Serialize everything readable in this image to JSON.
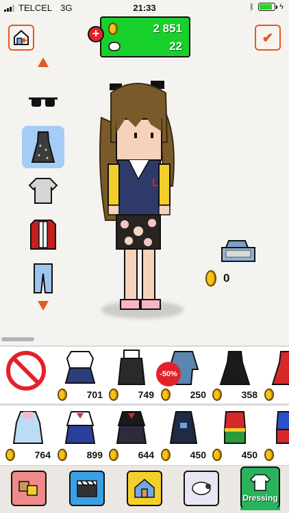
{
  "status_bar": {
    "carrier": "TELCEL",
    "network": "3G",
    "time": "21:33",
    "battery_percent": 0.85
  },
  "currency": {
    "coins": "2 851",
    "gems": "22"
  },
  "selected_item_price": "0",
  "sale_badge": "-50%",
  "items_row1": [
    {
      "name": "school-uniform",
      "price": "701"
    },
    {
      "name": "black-overall-dress",
      "price": "749"
    },
    {
      "name": "denim-jacket-dress",
      "price": "250"
    },
    {
      "name": "black-gown",
      "price": "358"
    }
  ],
  "items_row2": [
    {
      "name": "pastel-dress",
      "price": "764"
    },
    {
      "name": "sailor-uniform-blue",
      "price": "899"
    },
    {
      "name": "sailor-uniform-black",
      "price": "644"
    },
    {
      "name": "dark-costume",
      "price": "450"
    },
    {
      "name": "hero-costume",
      "price": "450"
    }
  ],
  "tabs": {
    "dressing_label": "Dressing"
  },
  "colors": {
    "accent": "#e05a22",
    "currency_bg": "#17d02c",
    "active_category": "#a6cbf5",
    "dressing_tab": "#28b35c"
  },
  "icons": [
    "home-icon",
    "check-icon",
    "coin-icon",
    "gem-icon",
    "sunglasses-icon",
    "dress-icon",
    "shirt-icon",
    "jacket-icon",
    "jeans-icon",
    "cash-register-icon",
    "no-icon"
  ]
}
